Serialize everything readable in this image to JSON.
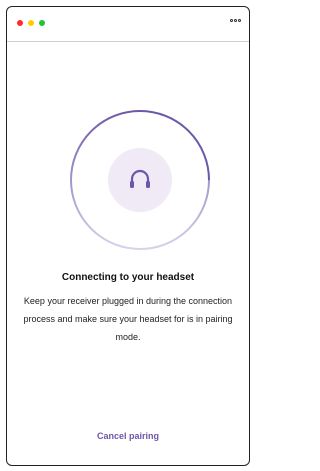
{
  "window": {
    "controls": [
      "close",
      "minimize",
      "maximize"
    ],
    "menu_icon": "more-options-icon"
  },
  "pairing": {
    "icon": "headset-icon",
    "title": "Connecting to your headset",
    "message": "Keep your receiver plugged in during the connection process and make sure your headset for is in pairing mode.",
    "cancel_label": "Cancel pairing"
  },
  "colors": {
    "accent": "#6d57a8",
    "icon_bg": "#efeaf6",
    "close": "#ff2a2a",
    "minimize": "#ffcc00",
    "maximize": "#1fc23a"
  }
}
